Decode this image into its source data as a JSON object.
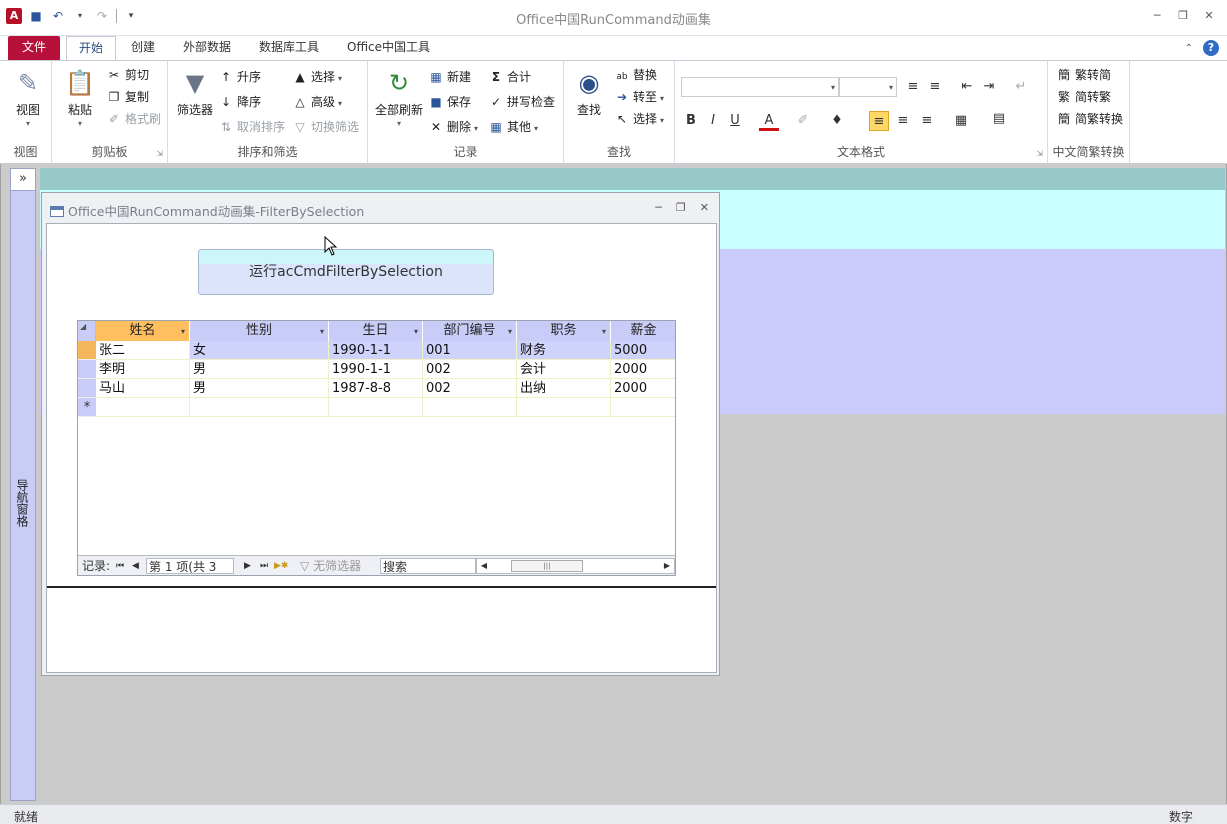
{
  "app": {
    "icon_letter": "A",
    "title": "Office中国RunCommand动画集"
  },
  "tabs": [
    {
      "label": "文件"
    },
    {
      "label": "开始"
    },
    {
      "label": "创建"
    },
    {
      "label": "外部数据"
    },
    {
      "label": "数据库工具"
    },
    {
      "label": "Office中国工具"
    }
  ],
  "ribbon": {
    "view": {
      "label": "视图",
      "group": "视图"
    },
    "clipboard": {
      "paste": "粘贴",
      "cut": "剪切",
      "copy": "复制",
      "format_painter": "格式刷",
      "group": "剪贴板"
    },
    "sort_filter": {
      "filter": "筛选器",
      "asc": "升序",
      "desc": "降序",
      "clear_sort": "取消排序",
      "selection": "选择",
      "advanced": "高级",
      "toggle_filter": "切换筛选",
      "group": "排序和筛选"
    },
    "records": {
      "refresh_all": "全部刷新",
      "new": "新建",
      "save": "保存",
      "delete": "删除",
      "totals": "合计",
      "spelling": "拼写检查",
      "more": "其他",
      "group": "记录"
    },
    "find": {
      "find": "查找",
      "replace": "替换",
      "goto": "转至",
      "select": "选择",
      "group": "查找"
    },
    "text_format": {
      "bold": "B",
      "italic": "I",
      "underline": "U",
      "font_color": "A",
      "group": "文本格式"
    },
    "chinese_conv": {
      "to_simplified": "繁转简",
      "to_traditional": "简转繁",
      "convert": "简繁转换",
      "group": "中文简繁转换"
    }
  },
  "nav_pane": {
    "toggle": "»",
    "label": "导航窗格"
  },
  "form": {
    "title": "Office中国RunCommand动画集-FilterBySelection",
    "run_button": "运行acCmdFilterBySelection",
    "datasheet": {
      "columns": [
        "姓名",
        "性别",
        "生日",
        "部门编号",
        "职务",
        "薪金"
      ],
      "rows": [
        [
          "张二",
          "女",
          "1990-1-1",
          "001",
          "财务",
          "5000"
        ],
        [
          "李明",
          "男",
          "1990-1-1",
          "002",
          "会计",
          "2000"
        ],
        [
          "马山",
          "男",
          "1987-8-8",
          "002",
          "出纳",
          "2000"
        ]
      ],
      "new_row_marker": "*"
    },
    "record_nav": {
      "label": "记录:",
      "position": "第 1 项(共 3 项)",
      "no_filter": "无筛选器",
      "search": "搜索"
    }
  },
  "status": {
    "left": "就绪",
    "right": "数字"
  }
}
